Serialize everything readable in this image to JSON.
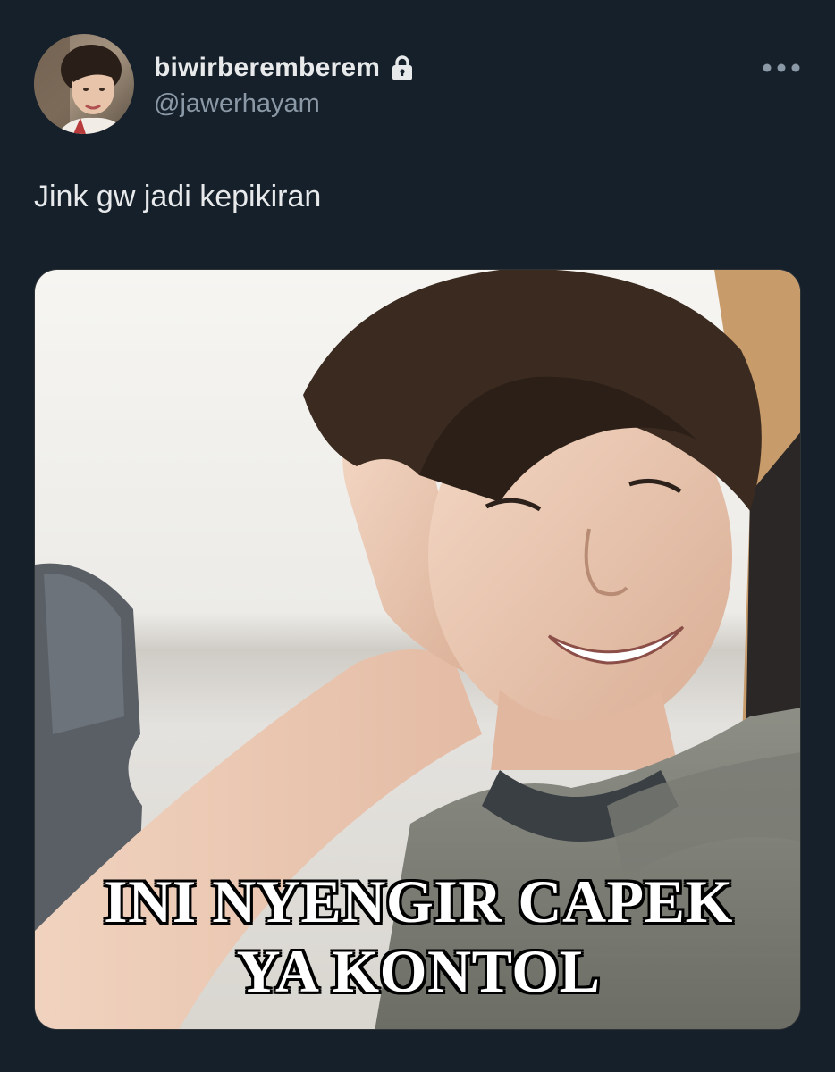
{
  "tweet": {
    "author": {
      "display_name": "biwirberemberem",
      "handle": "@jawerhayam",
      "protected": true,
      "avatar_icon": "profile-photo"
    },
    "more_icon": "more-horizontal-icon",
    "text": "Jink gw jadi kepikiran",
    "media": {
      "type": "meme-photo",
      "caption_line1": "INI NYENGIR CAPEK",
      "caption_line2": "YA KONTOL"
    }
  },
  "colors": {
    "background": "#15202b",
    "primary_text": "#e7e9ea",
    "secondary_text": "#8b98a5",
    "caption_text": "#ffffff",
    "caption_outline": "#000000"
  }
}
